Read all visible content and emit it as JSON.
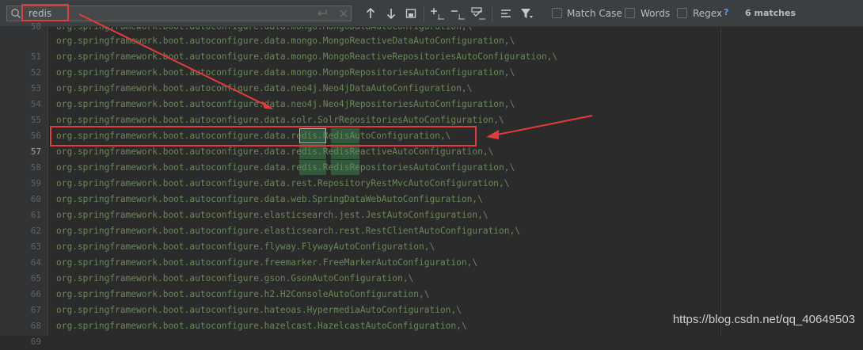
{
  "find_bar": {
    "query": "redis",
    "options": [
      {
        "label": "Match Case",
        "checked": false
      },
      {
        "label": "Words",
        "checked": false
      },
      {
        "label": "Regex",
        "checked": false
      }
    ],
    "help": "?",
    "match_count": "6 matches",
    "icons": [
      "search-icon",
      "newline-icon",
      "clear-icon",
      "prev-occurrence-icon",
      "next-occurrence-icon",
      "filter-search-results-icon",
      "add-selection-icon",
      "remove-selection-icon",
      "select-all-occurrences-icon",
      "multiline-icon",
      "filter-icon"
    ]
  },
  "editor": {
    "current_line": "57",
    "match_term": "redis",
    "lines": [
      {
        "num": "50",
        "text": "org.springframework.boot.autoconfigure.data.mongo.MongoDataAutoConfiguration,\\"
      },
      {
        "num": "51",
        "text": "org.springframework.boot.autoconfigure.data.mongo.MongoReactiveDataAutoConfiguration,\\"
      },
      {
        "num": "52",
        "text": "org.springframework.boot.autoconfigure.data.mongo.MongoReactiveRepositoriesAutoConfiguration,\\"
      },
      {
        "num": "53",
        "text": "org.springframework.boot.autoconfigure.data.mongo.MongoRepositoriesAutoConfiguration,\\"
      },
      {
        "num": "54",
        "text": "org.springframework.boot.autoconfigure.data.neo4j.Neo4jDataAutoConfiguration,\\"
      },
      {
        "num": "55",
        "text": "org.springframework.boot.autoconfigure.data.neo4j.Neo4jRepositoriesAutoConfiguration,\\"
      },
      {
        "num": "56",
        "text": "org.springframework.boot.autoconfigure.data.solr.SolrRepositoriesAutoConfiguration,\\"
      },
      {
        "num": "57",
        "text": "org.springframework.boot.autoconfigure.data.redis.RedisAutoConfiguration,\\"
      },
      {
        "num": "58",
        "text": "org.springframework.boot.autoconfigure.data.redis.RedisReactiveAutoConfiguration,\\"
      },
      {
        "num": "59",
        "text": "org.springframework.boot.autoconfigure.data.redis.RedisRepositoriesAutoConfiguration,\\"
      },
      {
        "num": "60",
        "text": "org.springframework.boot.autoconfigure.data.rest.RepositoryRestMvcAutoConfiguration,\\"
      },
      {
        "num": "61",
        "text": "org.springframework.boot.autoconfigure.data.web.SpringDataWebAutoConfiguration,\\"
      },
      {
        "num": "62",
        "text": "org.springframework.boot.autoconfigure.elasticsearch.jest.JestAutoConfiguration,\\"
      },
      {
        "num": "63",
        "text": "org.springframework.boot.autoconfigure.elasticsearch.rest.RestClientAutoConfiguration,\\"
      },
      {
        "num": "64",
        "text": "org.springframework.boot.autoconfigure.flyway.FlywayAutoConfiguration,\\"
      },
      {
        "num": "65",
        "text": "org.springframework.boot.autoconfigure.freemarker.FreeMarkerAutoConfiguration,\\"
      },
      {
        "num": "66",
        "text": "org.springframework.boot.autoconfigure.gson.GsonAutoConfiguration,\\"
      },
      {
        "num": "67",
        "text": "org.springframework.boot.autoconfigure.h2.H2ConsoleAutoConfiguration,\\"
      },
      {
        "num": "68",
        "text": "org.springframework.boot.autoconfigure.hateoas.HypermediaAutoConfiguration,\\"
      },
      {
        "num": "69",
        "text": "org.springframework.boot.autoconfigure.hazelcast.HazelcastAutoConfiguration,\\"
      }
    ]
  },
  "annotations": {
    "highlight_color": "#e23b3b",
    "watermark": "https://blog.csdn.net/qq_40649503"
  },
  "colors": {
    "background": "#2b2b2b",
    "gutter": "#313335",
    "code_text": "#6a8759",
    "match_background": "#32593d",
    "toolbar": "#3c3f41"
  }
}
